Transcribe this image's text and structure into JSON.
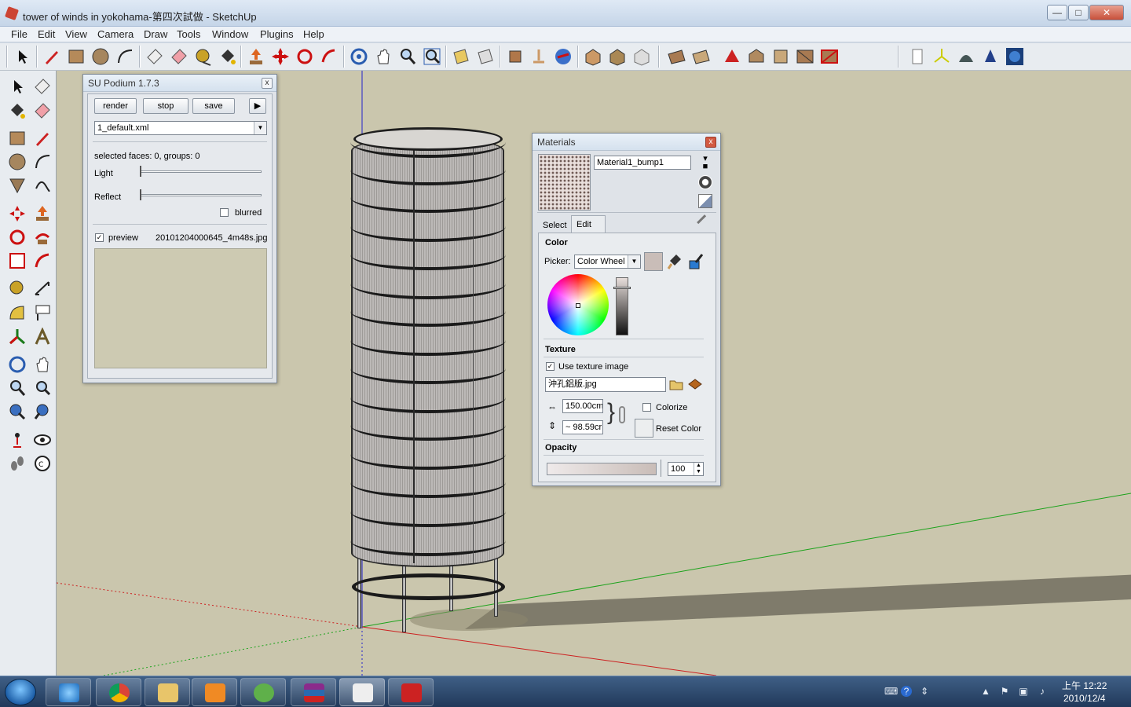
{
  "window": {
    "title": "tower of winds in yokohama-第四次試做 - SketchUp",
    "minimize": "—",
    "maximize": "□",
    "close": "✕"
  },
  "menu": [
    "File",
    "Edit",
    "View",
    "Camera",
    "Draw",
    "Tools",
    "Window",
    "Plugins",
    "Help"
  ],
  "podium": {
    "title": "SU Podium 1.7.3",
    "render_label": "render",
    "stop_label": "stop",
    "save_label": "save",
    "play_label": "▶",
    "preset_value": "1_default.xml",
    "selected_text": "selected faces: 0, groups: 0",
    "light_label": "Light",
    "reflect_label": "Reflect",
    "blurred_label": "blurred",
    "blurred_checked": false,
    "preview_label": "preview",
    "preview_checked": true,
    "preview_file": "20101204000645_4m48s.jpg",
    "close": "x"
  },
  "materials": {
    "title": "Materials",
    "close": "x",
    "name_value": "Material1_bump1",
    "tab_select": "Select",
    "tab_edit": "Edit",
    "color_heading": "Color",
    "picker_label": "Picker:",
    "picker_value": "Color Wheel",
    "texture_heading": "Texture",
    "use_texture_label": "Use texture image",
    "use_texture_checked": true,
    "texture_file": "沖孔鋁版.jpg",
    "width_value": "150.00cm",
    "height_value": "~ 98.59cr",
    "colorize_label": "Colorize",
    "reset_color_label": "Reset Color",
    "opacity_heading": "Opacity",
    "opacity_value": "100",
    "swatch_color": "#c9bdb8"
  },
  "taskbar": {
    "clock_time": "上午 12:22",
    "clock_date": "2010/12/4"
  },
  "icons": {
    "toolbar": [
      "select-icon",
      "pencil-icon",
      "rectangle-icon",
      "circle-icon",
      "arc-icon",
      "eraser-icon",
      "eraser-icon",
      "tape-measure-icon",
      "paint-bucket-icon",
      "push-pull-icon",
      "move-icon",
      "rotate-icon",
      "follow-me-icon",
      "orbit-icon",
      "pan-icon",
      "zoom-icon",
      "zoom-extents-icon",
      "section-plane-icon",
      "display-section-icon",
      "components-icon",
      "3d-warehouse-icon",
      "google-earth-icon",
      "get-models-icon",
      "share-model-icon",
      "sandbox-icon",
      "texture-icon",
      "stamp-icon",
      "drape-icon",
      "add-detail-icon",
      "flip-edge-icon",
      "podium-icon",
      "axes-icon",
      "shadows-icon",
      "fog-icon",
      "sketchup-icon"
    ]
  }
}
